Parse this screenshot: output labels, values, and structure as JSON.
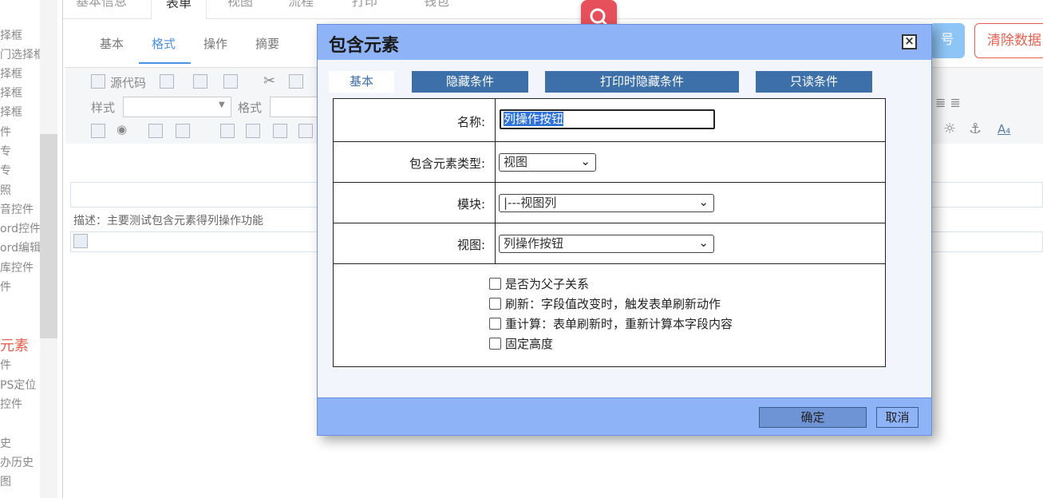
{
  "sidebar": {
    "items": [
      "择框",
      "门选择框",
      "择框",
      "择框",
      "择框",
      "件",
      "专",
      "专",
      "照",
      "音控件",
      "ord控件",
      "ord编辑",
      "库控件",
      "件",
      "元素",
      "件",
      "PS定位",
      "控件",
      "史",
      "办历史",
      "图"
    ]
  },
  "main_tabs": [
    "基本信息",
    "表单",
    "视图",
    "流程",
    "打印",
    "钱包"
  ],
  "sub_tabs": [
    "基本",
    "格式",
    "操作",
    "摘要"
  ],
  "top_buttons": {
    "blue_label": "号",
    "clear_label": "清除数据"
  },
  "toolbar": {
    "source_code": "源代码",
    "style_label": "样式",
    "format_label": "格式"
  },
  "form": {
    "description": "描述：主要测试包含元素得列操作功能"
  },
  "dialog": {
    "title": "包含元素",
    "close": "⊠",
    "tabs": [
      "基本",
      "隐藏条件",
      "打印时隐藏条件",
      "只读条件"
    ],
    "fields": {
      "name_label": "名称:",
      "name_value": "列操作按钮",
      "type_label": "包含元素类型:",
      "type_value": "视图",
      "module_label": "模块:",
      "module_value": "|---视图列",
      "view_label": "视图:",
      "view_value": "列操作按钮"
    },
    "checkboxes": [
      "是否为父子关系",
      "刷新：字段值改变时，触发表单刷新动作",
      "重计算：表单刷新时，重新计算本字段内容",
      "固定高度"
    ],
    "buttons": {
      "ok": "确定",
      "cancel": "取消"
    }
  }
}
